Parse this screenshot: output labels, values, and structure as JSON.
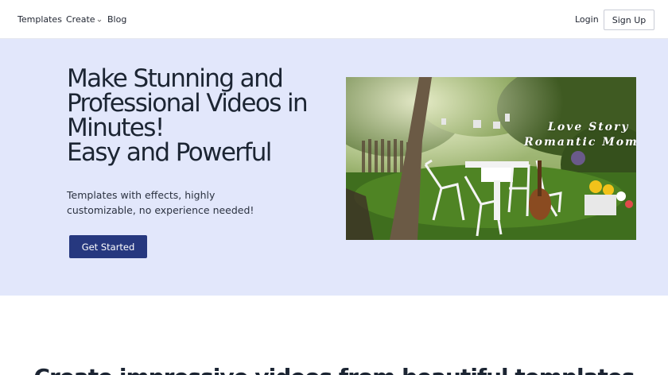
{
  "nav": {
    "templates": "Templates",
    "create": "Create",
    "blog": "Blog",
    "login": "Login",
    "signup": "Sign Up"
  },
  "hero": {
    "headline_lines": [
      "Make Stunning and",
      "Professional Videos in",
      "Minutes!",
      "Easy and Powerful"
    ],
    "subtext": "Templates with effects, highly customizable, no experience needed!",
    "cta": "Get Started",
    "video_text_1": "Love Story",
    "video_text_2": "Romantic Moment"
  },
  "section": {
    "title": "Create impressive videos from beautiful templates"
  },
  "colors": {
    "hero_bg": "#e2e7fb",
    "cta_bg": "#26387f",
    "text": "#1c2533"
  }
}
